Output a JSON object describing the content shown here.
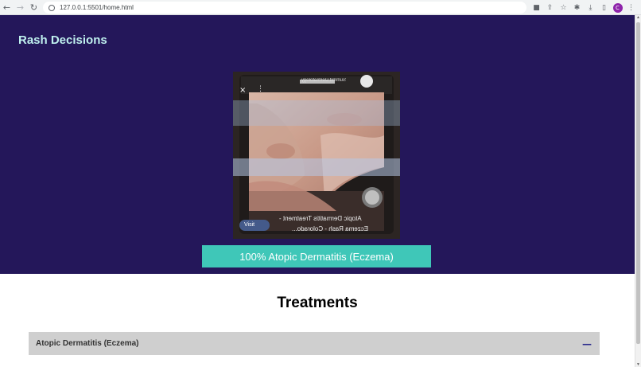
{
  "browser": {
    "url": "127.0.0.1:5501/home.html",
    "profile_initial": "C"
  },
  "header": {
    "title": "Rash Decisions"
  },
  "diagnosis": {
    "image_caption_line1": "Atopic Dermatitis Treatment -",
    "image_caption_line2": "Eczema Rash - Colorado...",
    "image_source": "Summit Dermatology",
    "image_visit_button": "Visit",
    "result": "100% Atopic Dermatitis (Eczema)"
  },
  "treatments": {
    "heading": "Treatments",
    "items": [
      {
        "label": "Atopic Dermatitis (Eczema)",
        "toggle": "—"
      }
    ]
  },
  "colors": {
    "hero_bg": "#24175a",
    "brand_title": "#bff0ee",
    "result_bar": "#3fc7b8",
    "accordion_bg": "#cfcfcf"
  }
}
